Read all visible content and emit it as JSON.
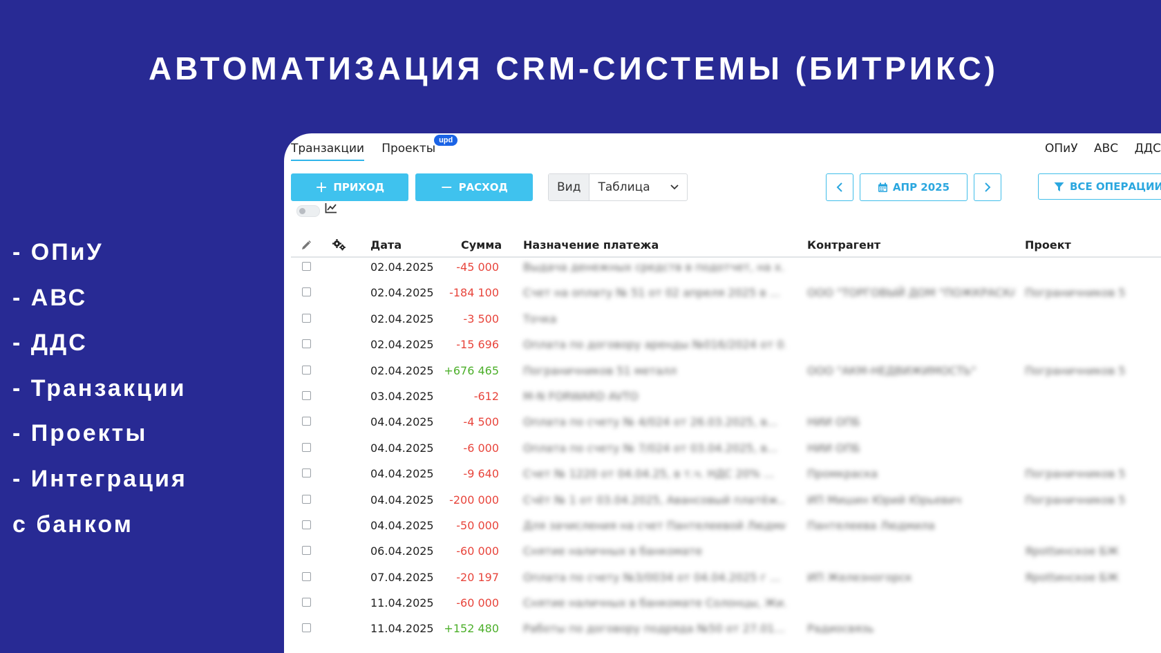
{
  "headline": "АВТОМАТИЗАЦИЯ CRM-СИСТЕМЫ (БИТРИКС)",
  "features": [
    "- ОПиУ",
    "- АВС",
    "- ДДС",
    "- Транзакции",
    "- Проекты",
    "- Интеграция",
    "с банком"
  ],
  "tabs": {
    "transactions": "Транзакции",
    "projects": "Проекты",
    "projects_badge": "upd"
  },
  "right_tabs": [
    "ОПиУ",
    "АВС",
    "ДДС"
  ],
  "toolbar": {
    "income_label": "ПРИХОД",
    "expense_label": "РАСХОД",
    "view_label": "Вид",
    "view_value": "Таблица",
    "period": "АПР 2025",
    "filter_label": "ВСЕ ОПЕРАЦИИ"
  },
  "icons": {
    "edit": "pencil-icon",
    "settings": "gears-icon",
    "calendar": "calendar-icon",
    "filter": "filter-icon",
    "chart": "line-chart-icon"
  },
  "colors": {
    "background": "#282a94",
    "accent": "#3fc2ee",
    "negative": "#e8453c",
    "positive": "#4caf2a"
  },
  "table": {
    "columns": {
      "date": "Дата",
      "amount": "Сумма",
      "purpose": "Назначение платежа",
      "counterparty": "Контрагент",
      "project": "Проект"
    },
    "rows": [
      {
        "date": "02.04.2025",
        "amount": "-45 000",
        "sign": "neg",
        "purpose": "Выдача денежных средств в подотчет, на х...",
        "counterparty": "",
        "project": ""
      },
      {
        "date": "02.04.2025",
        "amount": "-184 100",
        "sign": "neg",
        "purpose": "Счет на оплату № 51 от 02 апреля 2025 в ...",
        "counterparty": "ООО \"ТОРГОВЫЙ ДОМ \"ПОЖКРАСКА\"",
        "project": "Пограничников 5"
      },
      {
        "date": "02.04.2025",
        "amount": "-3 500",
        "sign": "neg",
        "purpose": "Точка",
        "counterparty": "",
        "project": ""
      },
      {
        "date": "02.04.2025",
        "amount": "-15 696",
        "sign": "neg",
        "purpose": "Оплата по договору аренды №016/2024 от 0...",
        "counterparty": "",
        "project": ""
      },
      {
        "date": "02.04.2025",
        "amount": "+676 465",
        "sign": "pos",
        "purpose": "Пограничников 51 металл",
        "counterparty": "ООО \"АКМ-НЕДВИЖИМОСТЬ\"",
        "project": "Пограничников 5"
      },
      {
        "date": "03.04.2025",
        "amount": "-612",
        "sign": "neg",
        "purpose": "M-N FORWARD AVTO",
        "counterparty": "",
        "project": ""
      },
      {
        "date": "04.04.2025",
        "amount": "-4 500",
        "sign": "neg",
        "purpose": "Оплата по счету № 4/024 от 26.03.2025, в...",
        "counterparty": "НИИ ОПБ",
        "project": ""
      },
      {
        "date": "04.04.2025",
        "amount": "-6 000",
        "sign": "neg",
        "purpose": "Оплата по счету № 7/024 от 03.04.2025, в...",
        "counterparty": "НИИ ОПБ",
        "project": ""
      },
      {
        "date": "04.04.2025",
        "amount": "-9 640",
        "sign": "neg",
        "purpose": "Счет № 1220 от 04.04.25, в т.ч. НДС 20% ...",
        "counterparty": "Промкраска",
        "project": "Пограничников 5"
      },
      {
        "date": "04.04.2025",
        "amount": "-200 000",
        "sign": "neg",
        "purpose": "Счёт № 1 от 03.04.2025, Авансовый платёж...",
        "counterparty": "ИП Мишин Юрий Юрьевич",
        "project": "Пограничников 5"
      },
      {
        "date": "04.04.2025",
        "amount": "-50 000",
        "sign": "neg",
        "purpose": "Для зачисления на счет Пантелеевой Людми...",
        "counterparty": "Пантелеева Людмила",
        "project": ""
      },
      {
        "date": "06.04.2025",
        "amount": "-60 000",
        "sign": "neg",
        "purpose": "Снятие наличных в банкомате",
        "counterparty": "",
        "project": "Ярottинское БЖ"
      },
      {
        "date": "07.04.2025",
        "amount": "-20 197",
        "sign": "neg",
        "purpose": "Оплата по счету №3/0034 от 04.04.2025 г ...",
        "counterparty": "ИП Железногорск",
        "project": "Ярottинское БЖ"
      },
      {
        "date": "11.04.2025",
        "amount": "-60 000",
        "sign": "neg",
        "purpose": "Снятие наличных в банкомате Солонцы, Жи...",
        "counterparty": "",
        "project": ""
      },
      {
        "date": "11.04.2025",
        "amount": "+152 480",
        "sign": "pos",
        "purpose": "Работы по договору подряда №50 от 27.01....",
        "counterparty": "Радиосвязь",
        "project": ""
      }
    ]
  }
}
